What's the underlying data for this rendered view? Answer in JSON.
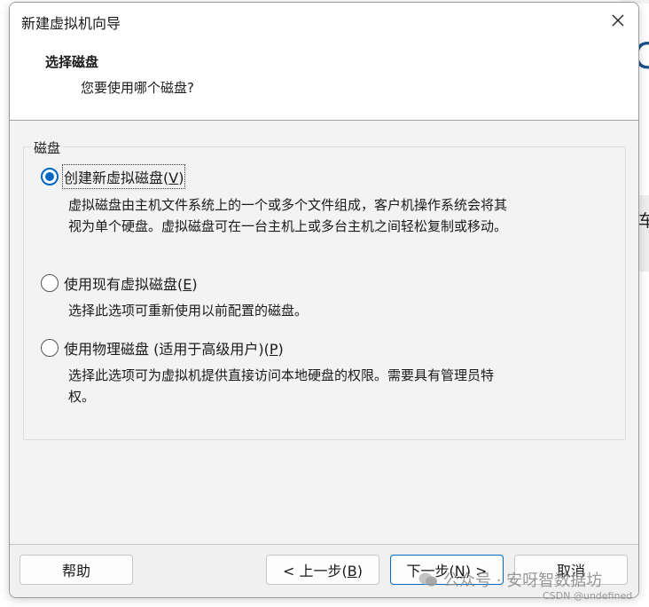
{
  "window": {
    "title": "新建虚拟机向导"
  },
  "header": {
    "title": "选择磁盘",
    "subtitle": "您要使用哪个磁盘?"
  },
  "group": {
    "label": "磁盘"
  },
  "options": [
    {
      "label": "创建新虚拟磁盘",
      "accel": "V",
      "checked": true,
      "description_lines": [
        "虚拟磁盘由主机文件系统上的一个或多个文件组成，客户机操作系统会将其",
        "视为单个硬盘。虚拟磁盘可在一台主机上或多台主机之间轻松复制或移动。"
      ]
    },
    {
      "label": "使用现有虚拟磁盘",
      "accel": "E",
      "checked": false,
      "description_lines": [
        "选择此选项可重新使用以前配置的磁盘。"
      ]
    },
    {
      "label": "使用物理磁盘 (适用于高级用户)",
      "accel": "P",
      "checked": false,
      "description_lines": [
        "选择此选项可为虚拟机提供直接访问本地硬盘的权限。需要具有管理员特",
        "权。"
      ]
    }
  ],
  "buttons": {
    "help": "帮助",
    "back": "< 上一步(",
    "back_accel": "B",
    "next": "下一步(",
    "next_accel": "N",
    "next_suffix": ") >",
    "cancel": "取消"
  },
  "background_app": {
    "side_char": "车"
  },
  "watermark": {
    "text": "公众号 · 安呀智数据坊",
    "source": "CSDN @undefined"
  },
  "colors": {
    "accent": "#0067c0"
  }
}
